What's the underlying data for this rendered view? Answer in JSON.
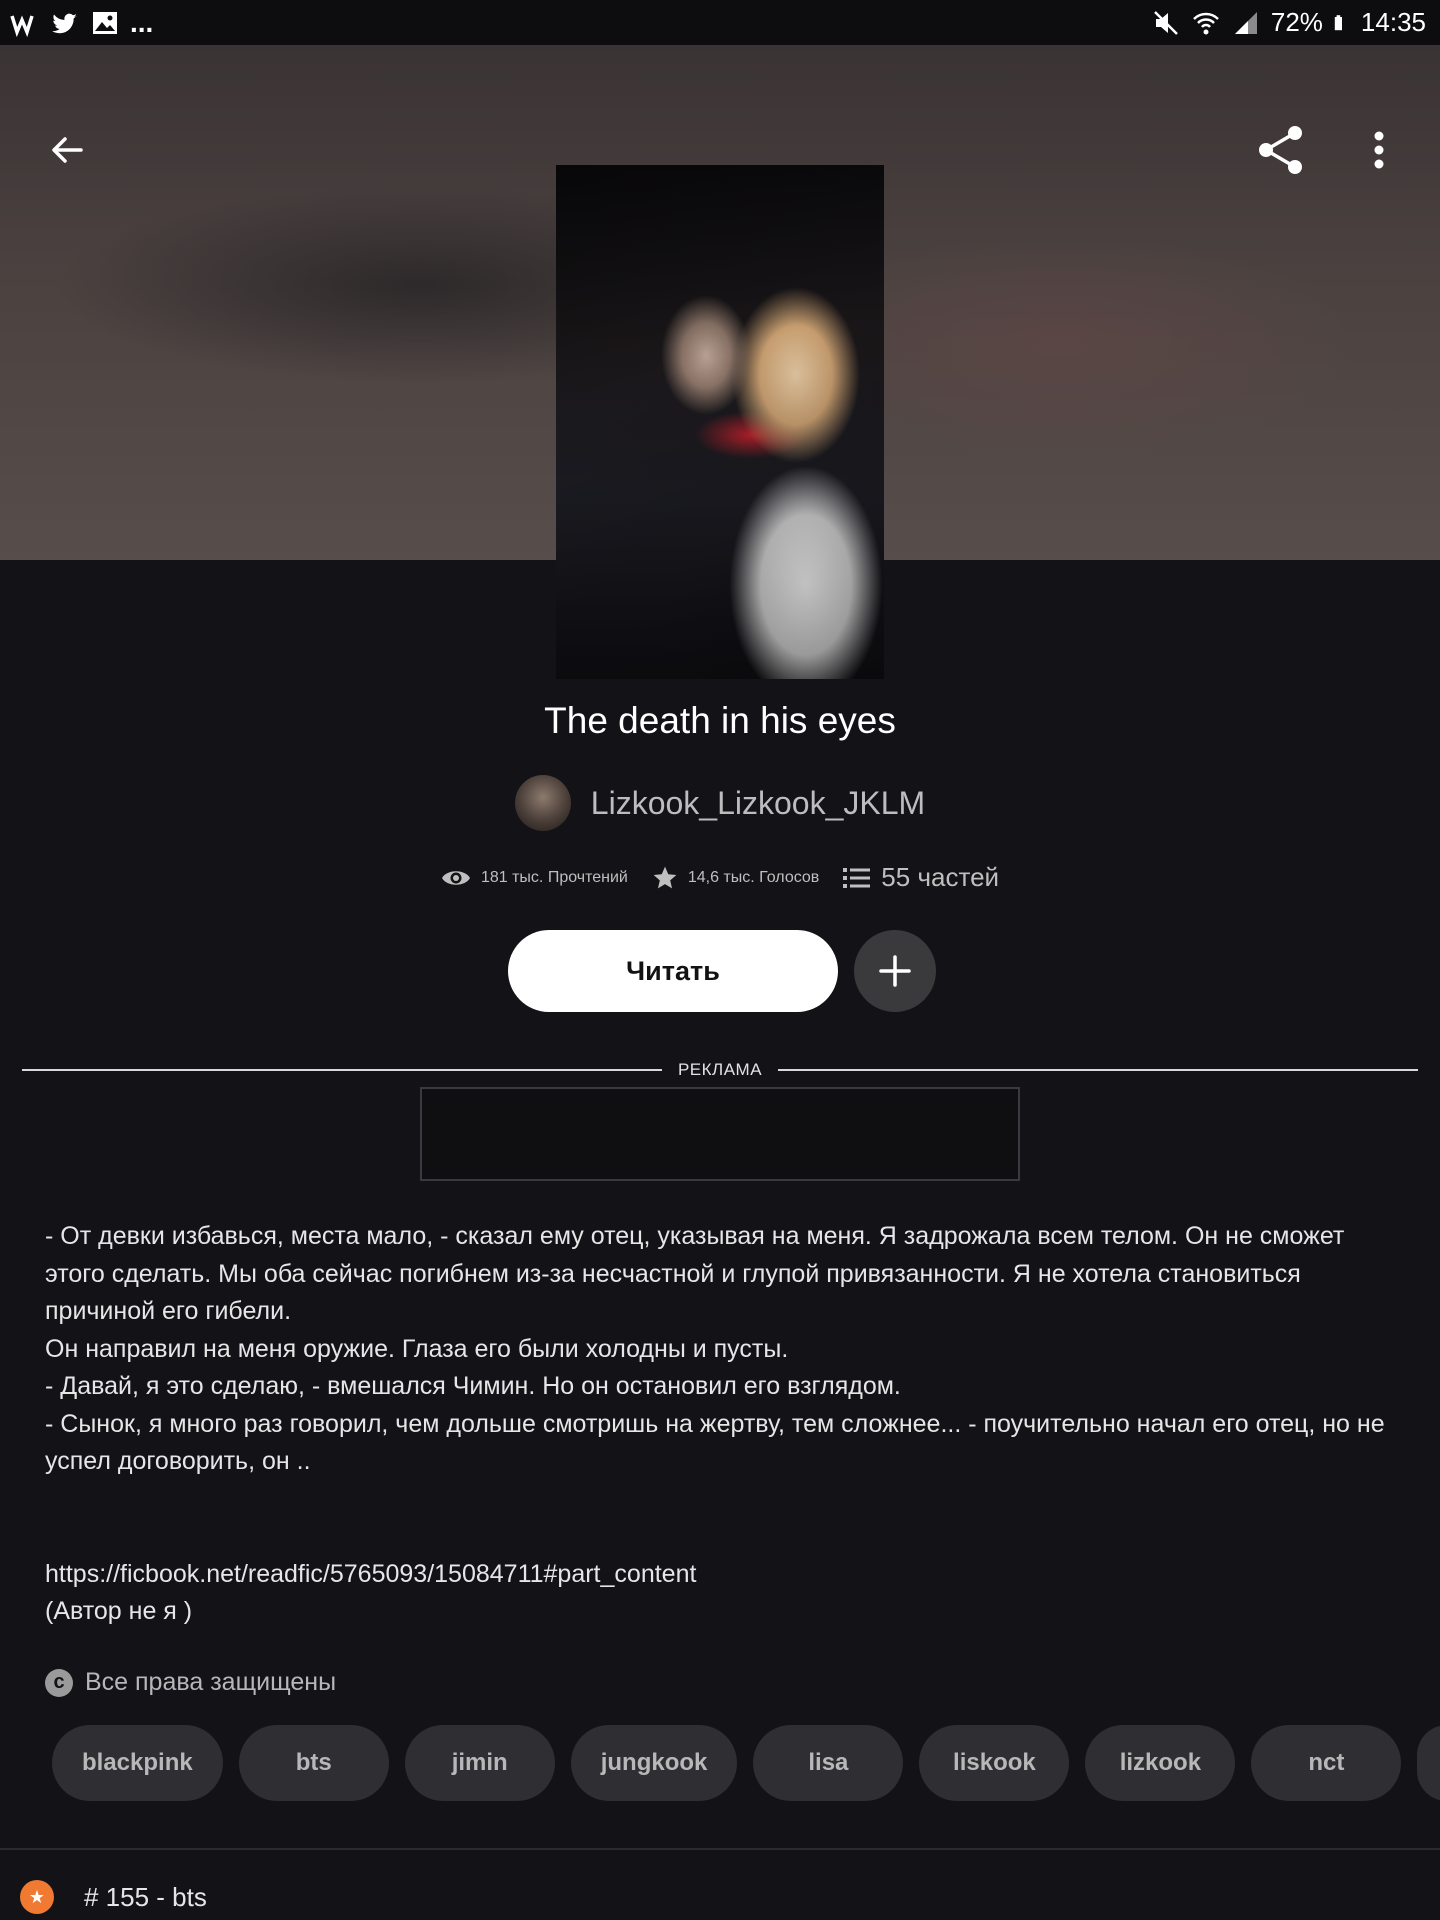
{
  "status_bar": {
    "notifications_more": "...",
    "battery": "72%",
    "time": "14:35",
    "icons": [
      "wattpad-icon",
      "twitter-icon",
      "image-icon",
      "mute-icon",
      "wifi-icon",
      "signal-icon",
      "battery-icon"
    ]
  },
  "header": {
    "back_icon": "arrow-left-icon",
    "share_icon": "share-icon",
    "more_icon": "more-vert-icon"
  },
  "story": {
    "title": "The death in his eyes",
    "author": "Lizkook_Lizkook_JKLM",
    "stats": {
      "reads": "181 тыс. Прочтений",
      "votes": "14,6 тыс. Голосов",
      "parts": "55 частей"
    },
    "read_button": "Читать",
    "ad_label": "РЕКЛАМА",
    "description": "- От девки избавься, места мало, - сказал ему отец, указывая на меня. Я задрожала всем телом. Он не сможет этого сделать. Мы оба сейчас погибнем из-за несчастной и глупой привязанности. Я не хотела становиться причиной его гибели.\nОн направил на меня оружие. Глаза его были холодны и пусты.\n- Давай, я это сделаю, - вмешался Чимин. Но он остановил его взглядом.\n- Сынок, я много раз говорил, чем дольше смотришь на жертву, тем сложнее... - поучительно начал его отец, но не успел договорить, он ..\n\n\nhttps://ficbook.net/readfic/5765093/15084711#part_content\n(Автор не я )",
    "rights": "Все права защищены",
    "tags": [
      "blackpink",
      "bts",
      "jimin",
      "jungkook",
      "lisa",
      "liskook",
      "lizkook",
      "nct"
    ],
    "rank": "# 155 - bts"
  },
  "colors": {
    "background": "#131217",
    "read_button_bg": "#ffffff",
    "tag_bg": "#2f2f33",
    "rank_badge": "#f07a32"
  }
}
